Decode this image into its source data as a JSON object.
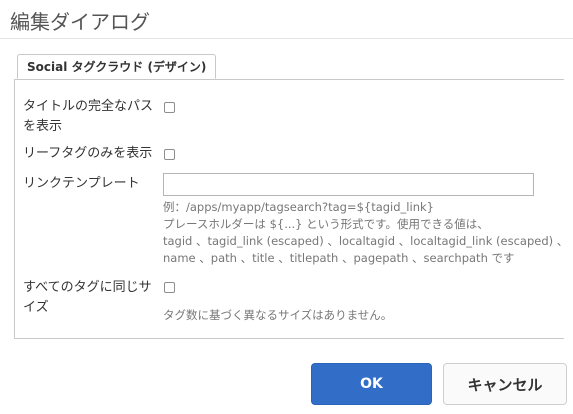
{
  "dialog": {
    "title": "編集ダイアログ"
  },
  "tabs": [
    {
      "label": "Social タグクラウド (デザイン)",
      "active": true
    }
  ],
  "form": {
    "full_title_path": {
      "label_line1": "タイトルの完全なパス",
      "label_line2": "を表示",
      "checked": false
    },
    "leaf_tags_only": {
      "label": "リーフタグのみを表示",
      "checked": false
    },
    "link_template": {
      "label": "リンクテンプレート",
      "value": "",
      "placeholder": "",
      "help_lines": [
        "例：/apps/myapp/tagsearch?tag=${tagid_link}",
        "プレースホルダーは ${...} という形式です。使用できる値は、",
        "tagid 、tagid_link (escaped) 、localtagid 、localtagid_link (escaped) 、",
        "name 、path 、title 、titlepath 、pagepath 、searchpath です"
      ]
    },
    "same_size": {
      "label_line1": "すべてのタグに同じサ",
      "label_line2": "イズ",
      "checked": false,
      "help": "タグ数に基づく異なるサイズはありません。"
    }
  },
  "footer": {
    "ok_label": "OK",
    "cancel_label": "キャンセル"
  },
  "colors": {
    "primary_button": "#326ec8",
    "help_text": "#777777",
    "border": "#c9c9c9"
  }
}
